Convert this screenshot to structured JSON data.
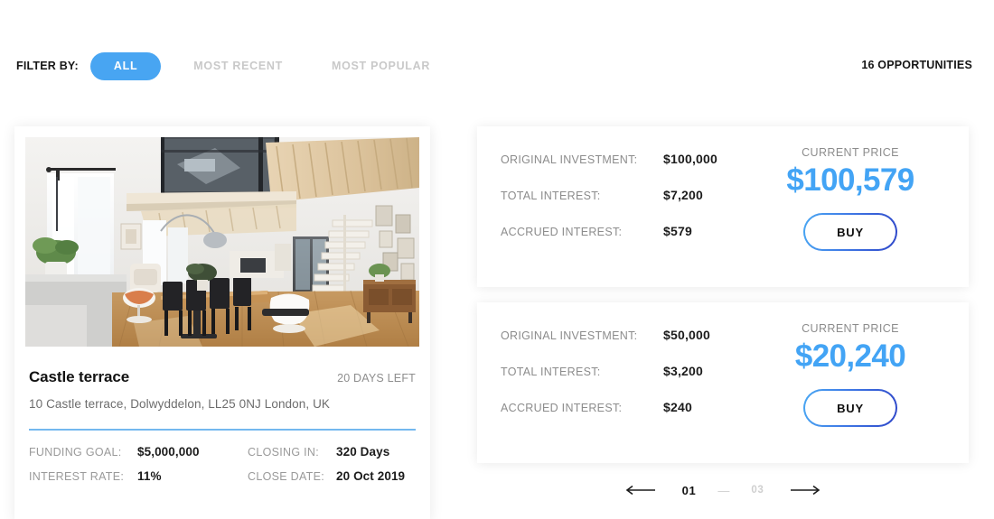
{
  "filter": {
    "label": "FILTER BY:",
    "tabs": [
      {
        "label": "ALL",
        "active": true
      },
      {
        "label": "MOST RECENT",
        "active": false
      },
      {
        "label": "MOST POPULAR",
        "active": false
      }
    ],
    "opportunities": "16 OPPORTUNITIES",
    "accent_color": "#48a5f2"
  },
  "property": {
    "photo_alt": "loft-interior-photo",
    "title": "Castle terrace",
    "days_left": "20 DAYS LEFT",
    "address": "10 Castle terrace, Dolwyddelon, LL25 0NJ London, UK",
    "divider_color": "#74b8ef",
    "stats": [
      {
        "key": "FUNDING GOAL:",
        "value": "$5,000,000"
      },
      {
        "key": "CLOSING IN:",
        "value": "320 Days"
      },
      {
        "key": "INTEREST RATE:",
        "value": "11%"
      },
      {
        "key": "CLOSE DATE:",
        "value": "20 Oct 2019"
      }
    ]
  },
  "investments": [
    {
      "rows": [
        {
          "key": "ORIGINAL INVESTMENT:",
          "value": "$100,000"
        },
        {
          "key": "TOTAL INTEREST:",
          "value": "$7,200"
        },
        {
          "key": "ACCRUED INTEREST:",
          "value": "$579"
        }
      ],
      "price_caption": "CURRENT PRICE",
      "price_value": "$100,579",
      "price_color": "#43a4f5",
      "buy_label": "BUY"
    },
    {
      "rows": [
        {
          "key": "ORIGINAL INVESTMENT:",
          "value": "$50,000"
        },
        {
          "key": "TOTAL INTEREST:",
          "value": "$3,200"
        },
        {
          "key": "ACCRUED INTEREST:",
          "value": "$240"
        }
      ],
      "price_caption": "CURRENT PRICE",
      "price_value": "$20,240",
      "price_color": "#43a4f5",
      "buy_label": "BUY"
    }
  ],
  "pagination": {
    "prev_icon": "arrow-left-icon",
    "next_icon": "arrow-right-icon",
    "current_page": "01",
    "separator": "—",
    "total_pages": "03"
  }
}
